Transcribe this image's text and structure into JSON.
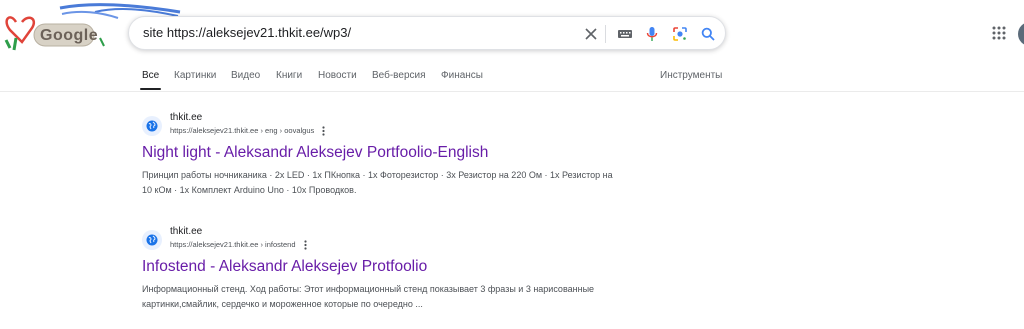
{
  "logo": {
    "text": "Google"
  },
  "search": {
    "query": "site https://aleksejev21.thkit.ee/wp3/"
  },
  "tabs": [
    {
      "label": "Все"
    },
    {
      "label": "Картинки"
    },
    {
      "label": "Видео"
    },
    {
      "label": "Книги"
    },
    {
      "label": "Новости"
    },
    {
      "label": "Веб-версия"
    },
    {
      "label": "Финансы"
    }
  ],
  "tools_label": "Инструменты",
  "results": [
    {
      "site_name": "thkit.ee",
      "url": "https://aleksejev21.thkit.ee › eng › oovalgus",
      "title": "Night light - Aleksandr Aleksejev Portfoolio-English",
      "snippet": "Принцип работы ночниканика · 2x LED · 1x ПКнопка · 1x Фоторезистор · 3x Резистор на 220 Ом · 1x Резистор на 10 кОм · 1x Комплект Arduino Uno · 10x Проводков."
    },
    {
      "site_name": "thkit.ee",
      "url": "https://aleksejev21.thkit.ee › infostend",
      "title": "Infostend - Aleksandr Aleksejev Protfoolio",
      "snippet": "Информационный стенд. Ход работы: Этот информационный стенд показывает 3 фразы и 3 нарисованные картинки,смайлик, сердечко и мороженное которые по очередно ..."
    }
  ],
  "colors": {
    "visited_link": "#681da8",
    "mic_blue": "#4285f4",
    "lens_red": "#ea4335"
  },
  "icons": [
    "clear-icon",
    "keyboard-icon",
    "mic-icon",
    "lens-icon",
    "search-icon",
    "apps-icon",
    "globe-icon",
    "more-vert-icon"
  ]
}
